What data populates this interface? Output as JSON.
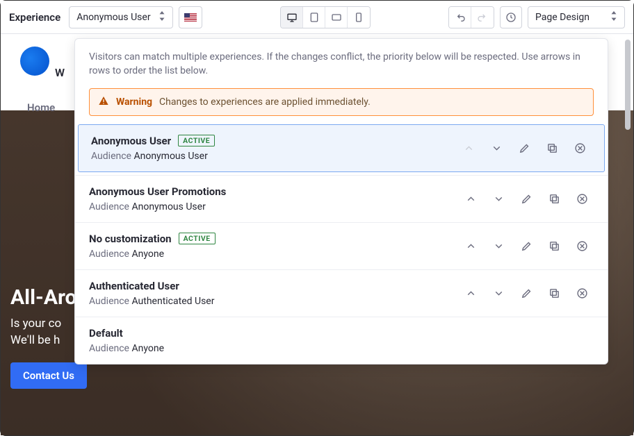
{
  "toolbar": {
    "label": "Experience",
    "experience_selected": "Anonymous User",
    "locale": "en-US",
    "page_mode": "Page Design"
  },
  "panel": {
    "help_text": "Visitors can match multiple experiences. If the changes conflict, the priority below will be respected. Use arrows in rows to order the list below.",
    "warning_title": "Warning",
    "warning_msg": "Changes to experiences are applied immediately.",
    "audience_label": "Audience",
    "active_badge": "ACTIVE",
    "experiences": [
      {
        "name": "Anonymous User",
        "audience": "Anonymous User",
        "active": true,
        "selected": true,
        "up_disabled": true
      },
      {
        "name": "Anonymous User Promotions",
        "audience": "Anonymous User",
        "active": false,
        "selected": false
      },
      {
        "name": "No customization",
        "audience": "Anyone",
        "active": true,
        "selected": false
      },
      {
        "name": "Authenticated User",
        "audience": "Authenticated User",
        "active": false,
        "selected": false
      },
      {
        "name": "Default",
        "audience": "Anyone",
        "active": false,
        "selected": false,
        "no_actions": true
      }
    ]
  },
  "site": {
    "nav_home": "Home",
    "hero_title": "All-Aro",
    "hero_line1": "Is your co",
    "hero_line2": "We'll be h",
    "contact_btn": "Contact Us"
  }
}
